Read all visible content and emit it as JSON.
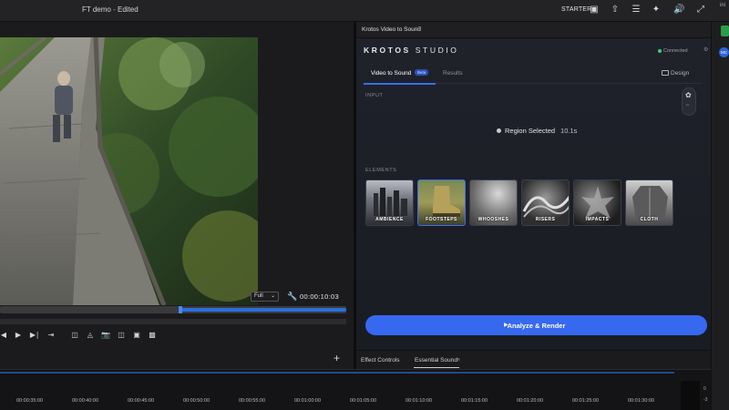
{
  "topbar": {
    "project": "FT demo",
    "separator": "-",
    "status": "Edited",
    "plan": "STARTER",
    "right_edge_text": "ini"
  },
  "video": {
    "quality": "Full",
    "timecode": "00:00:10:03"
  },
  "panel": {
    "title": "Krotos Video to Sound",
    "menu": "≡"
  },
  "krotos": {
    "brand_bold": "KROTOS",
    "brand_thin": "STUDIO",
    "connection": "Connected",
    "tabs": [
      {
        "label": "Video to Sound",
        "badge": "Beta",
        "active": true
      },
      {
        "label": "Results",
        "active": false
      }
    ],
    "design_label": "Design",
    "input_label": "INPUT",
    "region_label": "Region Selected",
    "region_duration": "10.1s",
    "elements_label": "ELEMENTS",
    "elements": [
      {
        "label": "AMBIENCE",
        "selected": false
      },
      {
        "label": "FOOTSTEPS",
        "selected": true
      },
      {
        "label": "WHOOSHES",
        "selected": false
      },
      {
        "label": "RISERS",
        "selected": false
      },
      {
        "label": "IMPACTS",
        "selected": false
      },
      {
        "label": "CLOTH",
        "selected": false
      }
    ],
    "render_label": "Analyze & Render"
  },
  "bottom_tabs": [
    {
      "label": "Effect Controls"
    },
    {
      "label": "Essential Sound",
      "menu": "≡"
    }
  ],
  "timeline": {
    "ticks": [
      "00:00:35:00",
      "00:00:40:00",
      "00:00:45:00",
      "00:00:50:00",
      "00:00:55:00",
      "00:01:00:00",
      "00:01:05:00",
      "00:01:10:00",
      "00:01:15:00",
      "00:01:20:00",
      "00:01:25:00",
      "00:01:30:00"
    ],
    "meter_top": "0",
    "meter_bottom": "-3"
  },
  "right_strip": {
    "badge": "MC"
  }
}
